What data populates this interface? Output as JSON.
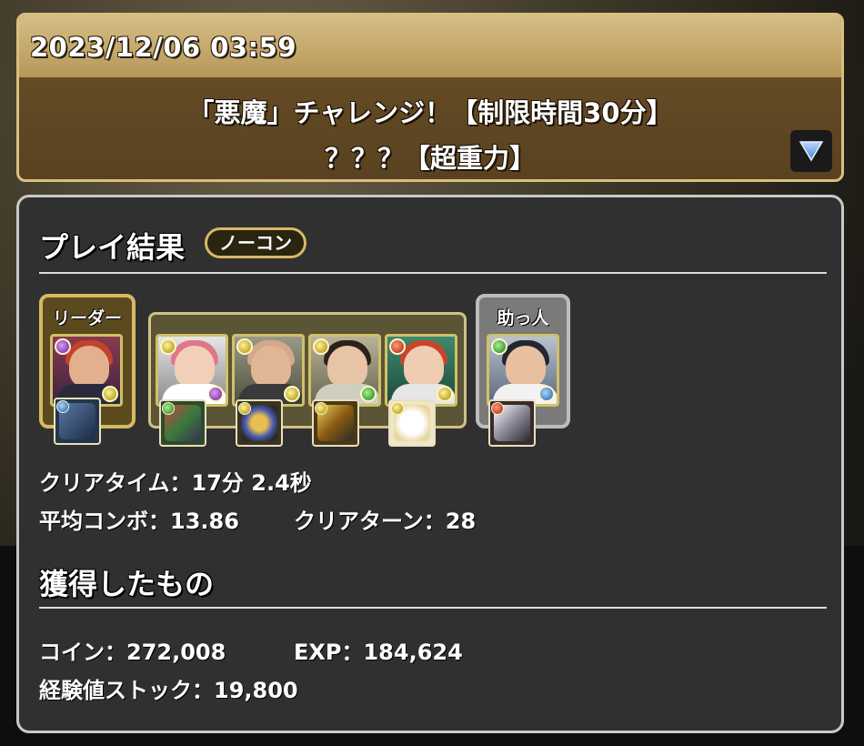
{
  "header": {
    "datetime": "2023/12/06 03:59",
    "title_line1": "「悪魔」チャレンジ！【制限時間30分】",
    "title_line2": "？？？【超重力】",
    "expand_icon": "triangle-down-icon"
  },
  "result": {
    "heading": "プレイ結果",
    "badge": "ノーコン",
    "leader_label": "リーダー",
    "helper_label": "助っ人",
    "team": [
      {
        "role": "leader",
        "main_attr": "purple",
        "sub_attr": "yellow",
        "assist_attr": "blue"
      },
      {
        "role": "sub",
        "main_attr": "yellow",
        "sub_attr": "purple",
        "assist_attr": "green"
      },
      {
        "role": "sub",
        "main_attr": "yellow",
        "sub_attr": "yellow",
        "assist_attr": "yellow"
      },
      {
        "role": "sub",
        "main_attr": "yellow",
        "sub_attr": "green",
        "assist_attr": "yellow"
      },
      {
        "role": "sub",
        "main_attr": "red",
        "sub_attr": "yellow",
        "assist_attr": "yellow"
      },
      {
        "role": "helper",
        "main_attr": "green",
        "sub_attr": "blue",
        "assist_attr": "red"
      }
    ],
    "clear_time": "クリアタイム：17分 2.4秒",
    "avg_combo": "平均コンボ：13.86",
    "clear_turns": "クリアターン：28"
  },
  "earned": {
    "heading": "獲得したもの",
    "coins": "コイン：272,008",
    "exp": "EXP：184,624",
    "exp_stock": "経験値ストック：19,800"
  },
  "colors": {
    "banner_gold": "#d6bd85",
    "banner_brown": "#5a4220",
    "panel_bg": "#303030",
    "badge_border": "#d7b964"
  }
}
